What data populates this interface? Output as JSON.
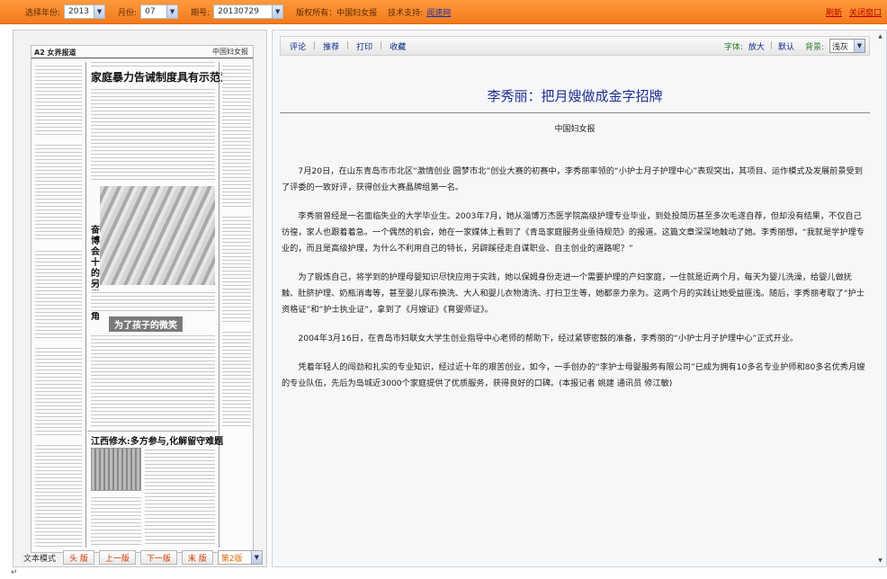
{
  "topbar": {
    "year_label": "选择年份:",
    "year_value": "2013",
    "month_label": "月份:",
    "month_value": "07",
    "issue_label": "期号:",
    "issue_value": "20130729",
    "copyright": "版权所有：中国妇女报",
    "support_label": "技术支持:",
    "support_link": "阅速网",
    "refresh": "刷新",
    "close": "关闭窗口",
    "accent_color": "#f58a2a"
  },
  "newspaper": {
    "page_no": "A2 女界报道",
    "masthead": "中国妇女报",
    "headline": "家庭暴力告诫制度具有示范意义",
    "side_headline": "奋博会十的另类主角",
    "mid_headline": "为了孩子的微笑",
    "bottom_headline": "江西修水:多方参与,化解留守难题"
  },
  "left_footer": {
    "mode_label": "文本模式",
    "buttons": [
      "头 版",
      "上一版",
      "下一版",
      "末 版"
    ],
    "page_select": "第2版"
  },
  "toolbar": {
    "items": [
      "评论",
      "推荐",
      "打印",
      "收藏"
    ],
    "font_label": "字体:",
    "font_large": "放大",
    "font_default": "默认",
    "bg_label": "背景:",
    "bg_value": "浅灰"
  },
  "article": {
    "title": "李秀丽：把月嫂做成金字招牌",
    "source": "中国妇女报",
    "paragraphs": [
      "7月20日，在山东青岛市市北区“激情创业 圆梦市北”创业大赛的初赛中，李秀丽率领的“小护士月子护理中心”表现突出，其项目、运作模式及发展前景受到了评委的一致好评，获得创业大赛晶牌组第一名。",
      "李秀丽曾经是一名面临失业的大学毕业生。2003年7月，她从淄博万杰医学院高级护理专业毕业，到处投简历甚至多次毛遂自荐，但却没有结果，不仅自己彷徨，家人也跟着着急。一个偶然的机会，她在一家媒体上看到了《青岛家庭服务业亟待规范》的报道。这篇文章深深地触动了她。李秀丽想，“我就是学护理专业的，而且是高级护理，为什么不利用自己的特长，另辟蹊径走自谋职业、自主创业的道路呢？”",
      "为了锻炼自己，将学到的护理母婴知识尽快应用于实践，她以保姆身份走进一个需要护理的产妇家庭，一住就是近两个月，每天为婴儿洗澡，给婴儿做抚触、肚脐护理、奶瓶消毒等，甚至婴儿尿布换洗、大人和婴儿衣物清洗、打扫卫生等，她都亲力亲为。这两个月的实践让她受益匪浅。随后，李秀丽考取了“护士资格证”和“护士执业证”，拿到了《月嫂证》《育婴师证》。",
      "2004年3月16日，在青岛市妇联女大学生创业指导中心老师的帮助下，经过紧锣密鼓的准备，李秀丽的“小护士月子护理中心”正式开业。",
      "凭着年轻人的闯劲和扎实的专业知识，经过近十年的艰苦创业，如今，一手创办的“李护士母婴服务有限公司”已成为拥有10多名专业护师和80多名优秀月嫂的专业队伍，先后为岛城近3000个家庭提供了优质服务，获得良好的口碑。(本报记者 姚建 通讯员 修江敏)"
    ],
    "title_color": "#1e2f8f"
  }
}
